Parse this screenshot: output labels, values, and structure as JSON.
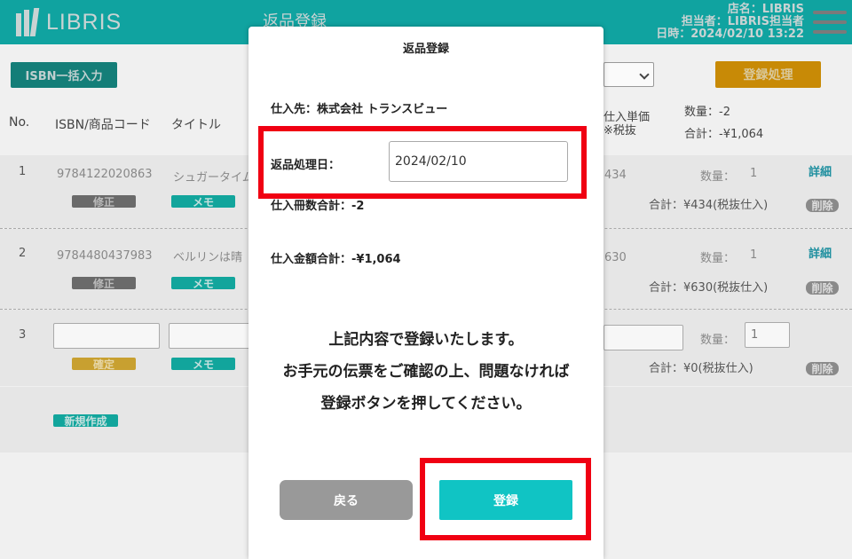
{
  "header": {
    "logo_text": "LIBRIS",
    "page_title": "返品登録",
    "store": "店名：LIBRIS",
    "staff": "担当者：LIBRIS担当者",
    "datetime": "日時：2024/02/10  13:22"
  },
  "toolbar": {
    "isbn_bulk_label": "ISBN一括入力",
    "register_label": "登録処理"
  },
  "table": {
    "headers": {
      "no": "No.",
      "isbn": "ISBN/商品コード",
      "title": "タイトル",
      "unit_price": [
        "仕入単価",
        "※税抜"
      ],
      "qty_total": "数量：-2",
      "sum_total": "合計：-¥1,064"
    },
    "rows": [
      {
        "no": "1",
        "isbn": "9784122020863",
        "title": "シュガータイム",
        "price": "434",
        "qty_label": "数量：",
        "qty": "1",
        "fix_label": "修正",
        "memo_label": "メモ",
        "sum": "合計：¥434(税抜仕入)",
        "detail_label": "詳細",
        "delete_label": "削除"
      },
      {
        "no": "2",
        "isbn": "9784480437983",
        "title": "ベルリンは晴",
        "price": "630",
        "qty_label": "数量：",
        "qty": "1",
        "fix_label": "修正",
        "memo_label": "メモ",
        "sum": "合計：¥630(税抜仕入)",
        "detail_label": "詳細",
        "delete_label": "削除"
      },
      {
        "no": "3",
        "qty_label": "数量：",
        "qty": "1",
        "confirm_label": "確定",
        "memo_label": "メモ",
        "sum": "合計：¥0(税抜仕入)",
        "delete_label": "削除"
      }
    ],
    "new_label": "新規作成"
  },
  "modal": {
    "title": "返品登録",
    "supplier": "仕入先：株式会社 トランスビュー",
    "return_date_label": "返品処理日：",
    "return_date_value": "2024/02/10",
    "total_qty": "仕入冊数合計：-2",
    "total_amount": "仕入金額合計：-¥1,064",
    "message_line1": "上記内容で登録いたします。",
    "message_line2": "お手元の伝票をご確認の上、問題なければ",
    "message_line3": "登録ボタンを押してください。",
    "back_label": "戻る",
    "submit_label": "登録"
  },
  "colors": {
    "header_teal": "#10a3a0",
    "submit_teal": "#10c4c4",
    "highlight_red": "#f00012",
    "orange_button": "#c88a06"
  }
}
